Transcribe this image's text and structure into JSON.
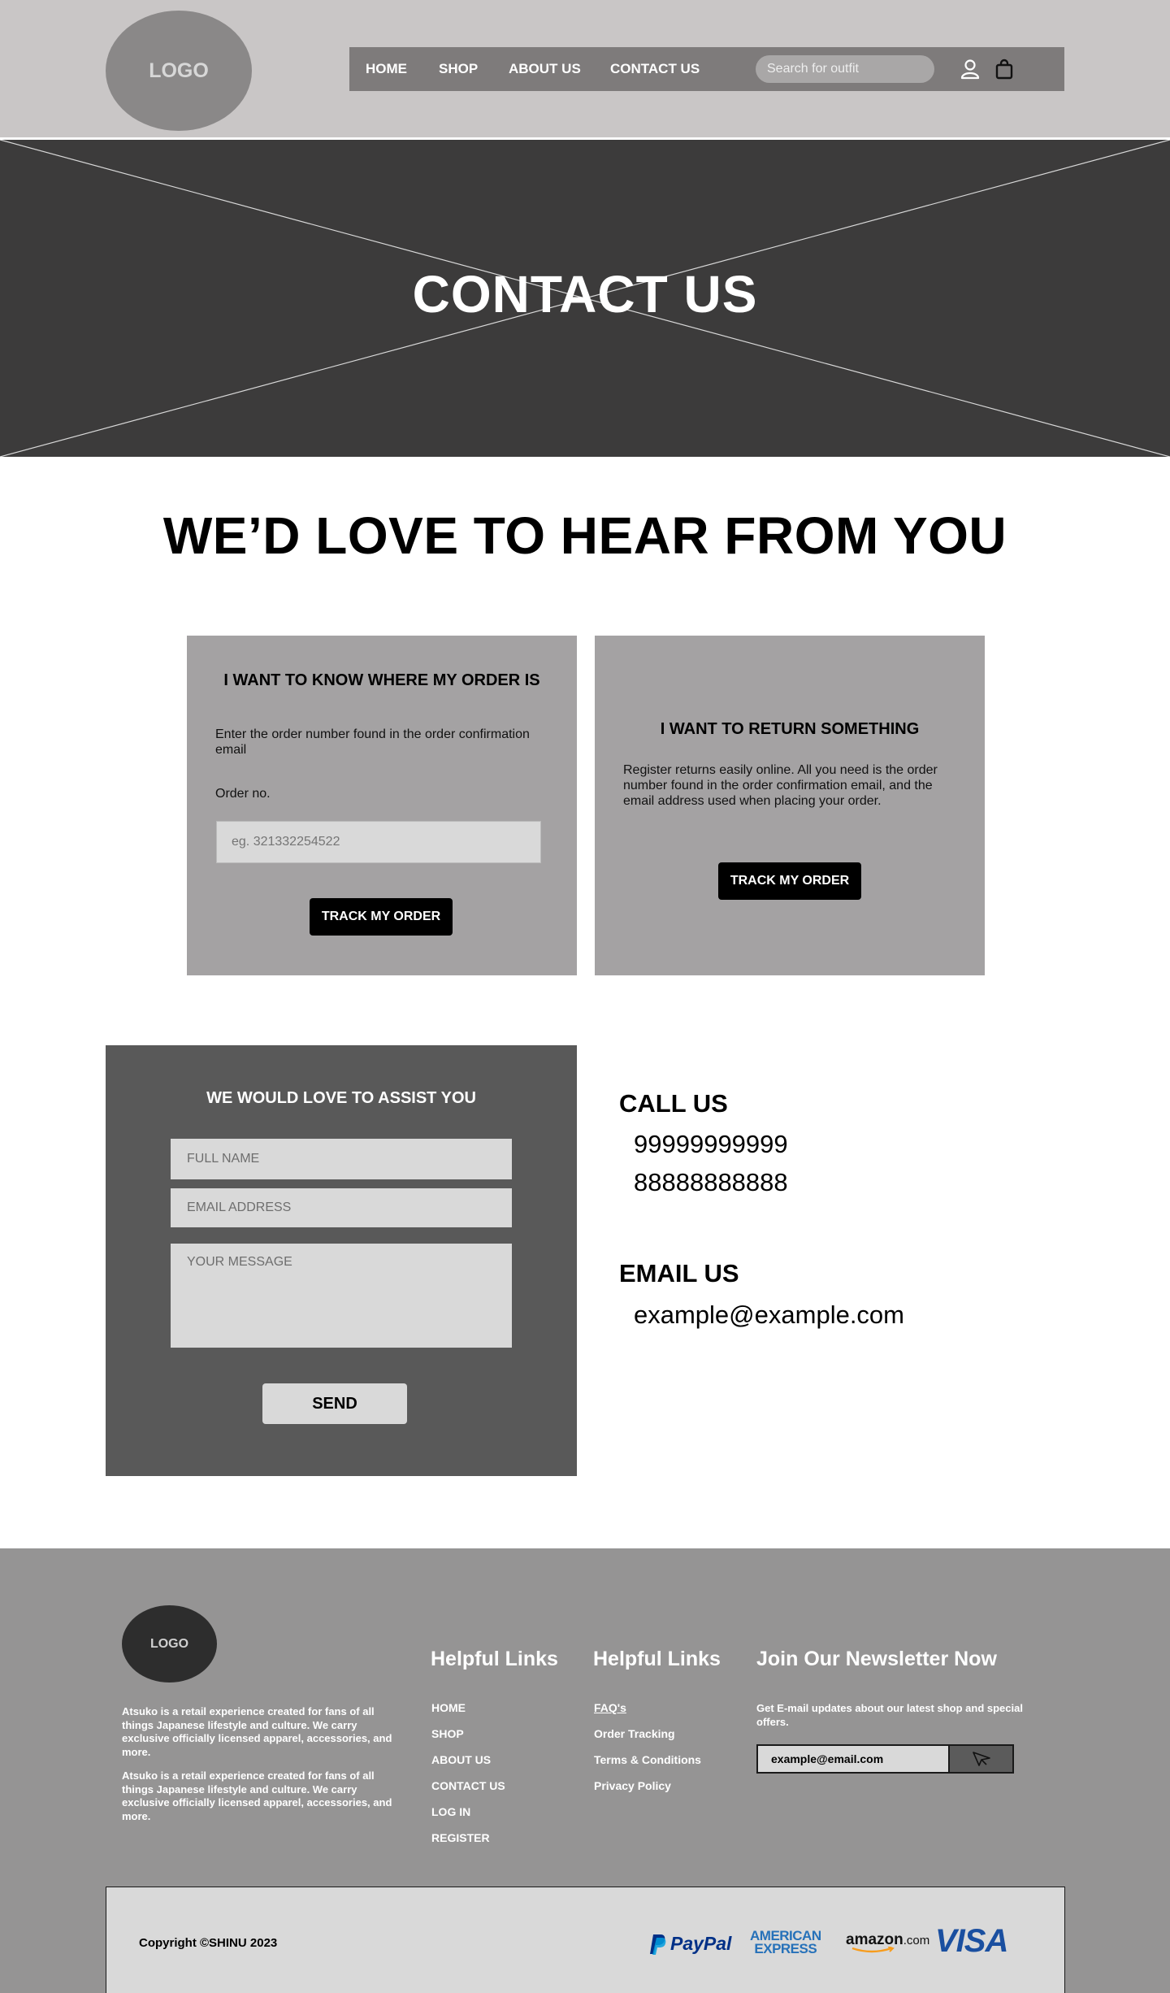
{
  "header": {
    "logo_text": "LOGO",
    "nav": [
      "HOME",
      "SHOP",
      "ABOUT US",
      "CONTACT US"
    ],
    "search_placeholder": "Search for outfit",
    "icons": [
      "user-icon",
      "shopping-bag-icon"
    ]
  },
  "hero": {
    "title": "CONTACT US"
  },
  "section": {
    "heading": "WE’D LOVE TO HEAR FROM YOU"
  },
  "order_card": {
    "title": "I WANT TO KNOW WHERE MY ORDER IS",
    "description": "Enter the order number found in the order confirmation email",
    "label": "Order no.",
    "placeholder": "eg. 321332254522",
    "button": "TRACK MY ORDER"
  },
  "return_card": {
    "title": "I WANT TO RETURN SOMETHING",
    "description": "Register returns easily online. All you need is the order number found in the order confirmation email, and the email address used when placing your order.",
    "button": "TRACK MY ORDER"
  },
  "assist_form": {
    "title": "WE WOULD LOVE TO ASSIST YOU",
    "name_placeholder": "FULL NAME",
    "email_placeholder": "EMAIL ADDRESS",
    "message_placeholder": "YOUR MESSAGE",
    "send": "SEND"
  },
  "contact": {
    "call_heading": "CALL US",
    "phones": [
      "99999999999",
      "88888888888"
    ],
    "email_heading": "EMAIL US",
    "email": "example@example.com"
  },
  "footer": {
    "logo_text": "LOGO",
    "about": [
      "Atsuko is a retail experience created for fans of all things Japanese lifestyle and culture. We carry exclusive officially licensed apparel, accessories, and more.",
      "Atsuko is a retail experience created for fans of all things Japanese lifestyle and culture. We carry exclusive officially licensed apparel, accessories, and more."
    ],
    "links1_heading": "Helpful Links",
    "links1": [
      "HOME",
      "SHOP",
      "ABOUT US",
      "CONTACT US",
      "LOG IN",
      "REGISTER"
    ],
    "links2_heading": "Helpful Links",
    "links2": [
      "FAQ's",
      "Order Tracking",
      "Terms & Conditions",
      "Privacy Policy"
    ],
    "newsletter_heading": "Join Our Newsletter Now",
    "newsletter_text": "Get E-mail updates about our latest shop and special offers.",
    "newsletter_placeholder": "example@email.com",
    "copyright": "Copyright ©SHINU 2023",
    "payments": {
      "paypal": "PayPal",
      "amex_line1": "AMERICAN",
      "amex_line2": "EXPRESS",
      "amazon": "amazon",
      "amazon_suffix": ".com",
      "visa": "VISA"
    },
    "colors": {
      "paypal_dark": "#003087",
      "paypal_light": "#009cde",
      "amex": "#2671b9",
      "visa": "#1a4fa0",
      "amazon_orange": "#f79c1c"
    }
  }
}
